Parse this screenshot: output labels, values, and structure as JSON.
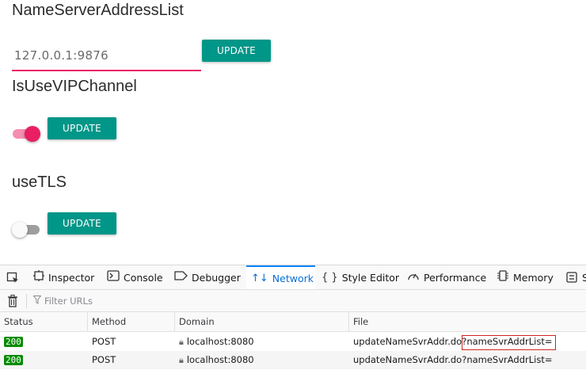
{
  "settings": {
    "nameserver": {
      "title": "NameServerAddressList",
      "value": "127.0.0.1:9876",
      "button": "UPDATE"
    },
    "vip_channel": {
      "title": "IsUseVIPChannel",
      "enabled": true,
      "button": "UPDATE"
    },
    "use_tls": {
      "title": "useTLS",
      "enabled": false,
      "button": "UPDATE"
    }
  },
  "devtools": {
    "tabs": [
      {
        "label": "Inspector",
        "icon": "inspector-icon"
      },
      {
        "label": "Console",
        "icon": "console-icon"
      },
      {
        "label": "Debugger",
        "icon": "debugger-icon"
      },
      {
        "label": "Network",
        "icon": "network-icon",
        "active": true
      },
      {
        "label": "Style Editor",
        "icon": "style-editor-icon"
      },
      {
        "label": "Performance",
        "icon": "performance-icon"
      },
      {
        "label": "Memory",
        "icon": "memory-icon"
      }
    ],
    "filter_placeholder": "Filter URLs",
    "columns": [
      "Status",
      "Method",
      "Domain",
      "File"
    ],
    "requests": [
      {
        "status": "200",
        "method": "POST",
        "domain": "localhost:8080",
        "file_path": "updateNameSvrAddr.do?",
        "file_query": "nameSvrAddrList="
      },
      {
        "status": "200",
        "method": "POST",
        "domain": "localhost:8080",
        "file_path": "updateNameSvrAddr.do?",
        "file_query": "nameSvrAddrList="
      }
    ],
    "colors": {
      "accent": "#0a84ff",
      "status_ok": "#058b00"
    }
  },
  "colors": {
    "primary_button": "#009688",
    "accent": "#e91e63"
  }
}
